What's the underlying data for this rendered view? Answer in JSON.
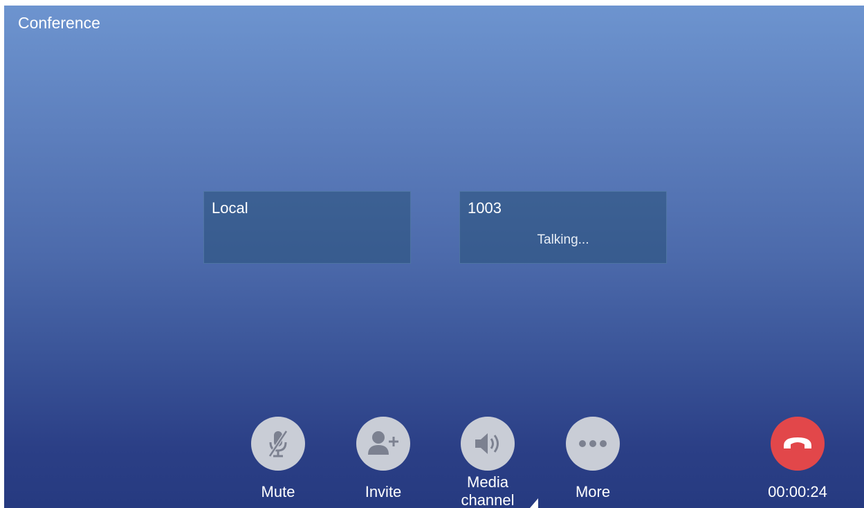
{
  "screen": {
    "title": "Conference"
  },
  "participants": [
    {
      "name": "Local",
      "status": ""
    },
    {
      "name": "1003",
      "status": "Talking..."
    }
  ],
  "controls": {
    "mute": "Mute",
    "invite": "Invite",
    "media_line1": "Media",
    "media_line2": "channel",
    "more": "More",
    "timer": "00:00:24"
  },
  "colors": {
    "hangup": "#e2474a",
    "button": "#c9cdd6",
    "icon": "#7c8190"
  },
  "icons": [
    "mic-muted-icon",
    "add-person-icon",
    "speaker-icon",
    "more-dots-icon",
    "hangup-phone-icon"
  ]
}
